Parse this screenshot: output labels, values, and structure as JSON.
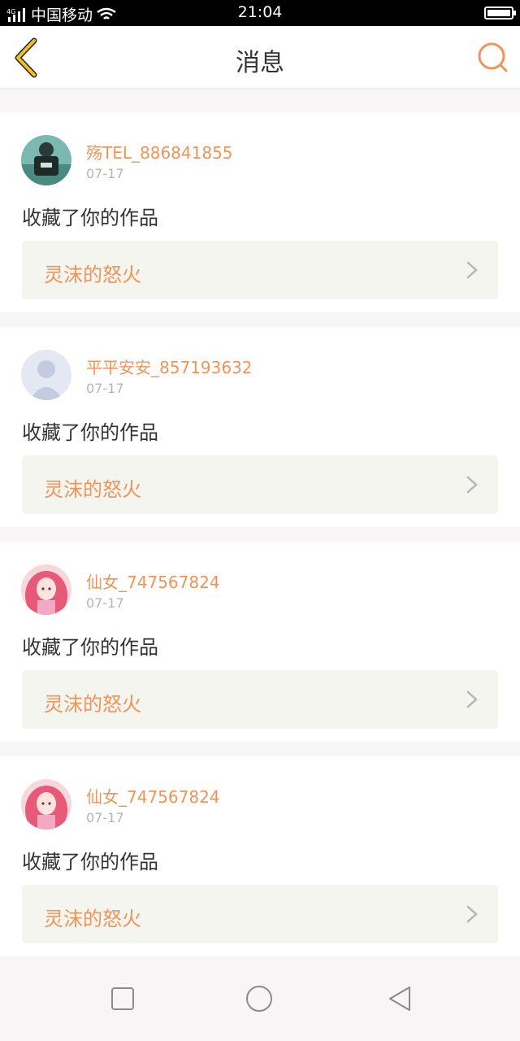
{
  "status_bar": {
    "carrier": "中国移动",
    "network": "4G",
    "time": "21:04"
  },
  "header": {
    "title": "消息",
    "back_icon": "chevron-left-icon",
    "search_icon": "search-icon"
  },
  "colors": {
    "accent": "#f0945a",
    "back_icon": "#f0c020"
  },
  "messages": [
    {
      "username": "殇TEL_886841855",
      "date": "07-17",
      "action": "收藏了你的作品",
      "work_title": "灵沫的怒火",
      "avatar": "dark-figure-avatar"
    },
    {
      "username": "平平安安_857193632",
      "date": "07-17",
      "action": "收藏了你的作品",
      "work_title": "灵沫的怒火",
      "avatar": "default-user-avatar"
    },
    {
      "username": "仙女_747567824",
      "date": "07-17",
      "action": "收藏了你的作品",
      "work_title": "灵沫的怒火",
      "avatar": "pink-anime-avatar"
    },
    {
      "username": "仙女_747567824",
      "date": "07-17",
      "action": "收藏了你的作品",
      "work_title": "灵沫的怒火",
      "avatar": "pink-anime-avatar"
    }
  ],
  "nav_bar": [
    "recents-square-icon",
    "home-circle-icon",
    "back-triangle-icon"
  ]
}
